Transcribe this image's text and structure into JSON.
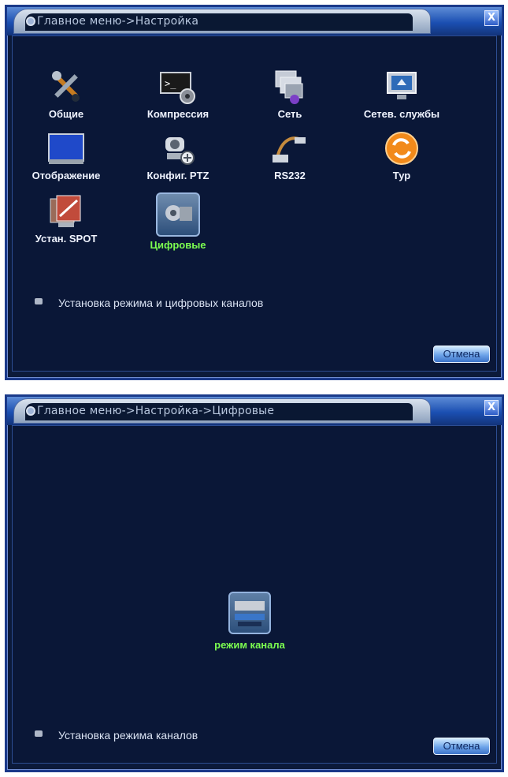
{
  "window1": {
    "title": "Главное меню->Настройка",
    "close_label": "X",
    "items": [
      {
        "label": "Общие",
        "icon": "tools-icon"
      },
      {
        "label": "Компрессия",
        "icon": "compression-icon"
      },
      {
        "label": "Сеть",
        "icon": "network-icon"
      },
      {
        "label": "Сетев. службы",
        "icon": "network-services-icon"
      },
      {
        "label": "Отображение",
        "icon": "display-icon"
      },
      {
        "label": "Конфиг. PTZ",
        "icon": "ptz-camera-icon"
      },
      {
        "label": "RS232",
        "icon": "rs232-cable-icon"
      },
      {
        "label": "Тур",
        "icon": "tour-refresh-icon"
      },
      {
        "label": "Устан. SPOT",
        "icon": "spot-output-icon"
      },
      {
        "label": "Цифровые",
        "icon": "digital-channel-icon"
      }
    ],
    "hint": "Установка режима и цифровых каналов",
    "cancel_label": "Отмена"
  },
  "window2": {
    "title": "Главное меню->Настройка->Цифровые",
    "close_label": "X",
    "channel_item": {
      "label": "режим канала",
      "icon": "channel-mode-icon"
    },
    "hint": "Установка режима каналов",
    "cancel_label": "Отмена"
  },
  "colors": {
    "background": "#0a1737",
    "title_bar": "#1b4fb2",
    "label_text": "#f0f4ff",
    "active_label": "#7cff50"
  }
}
